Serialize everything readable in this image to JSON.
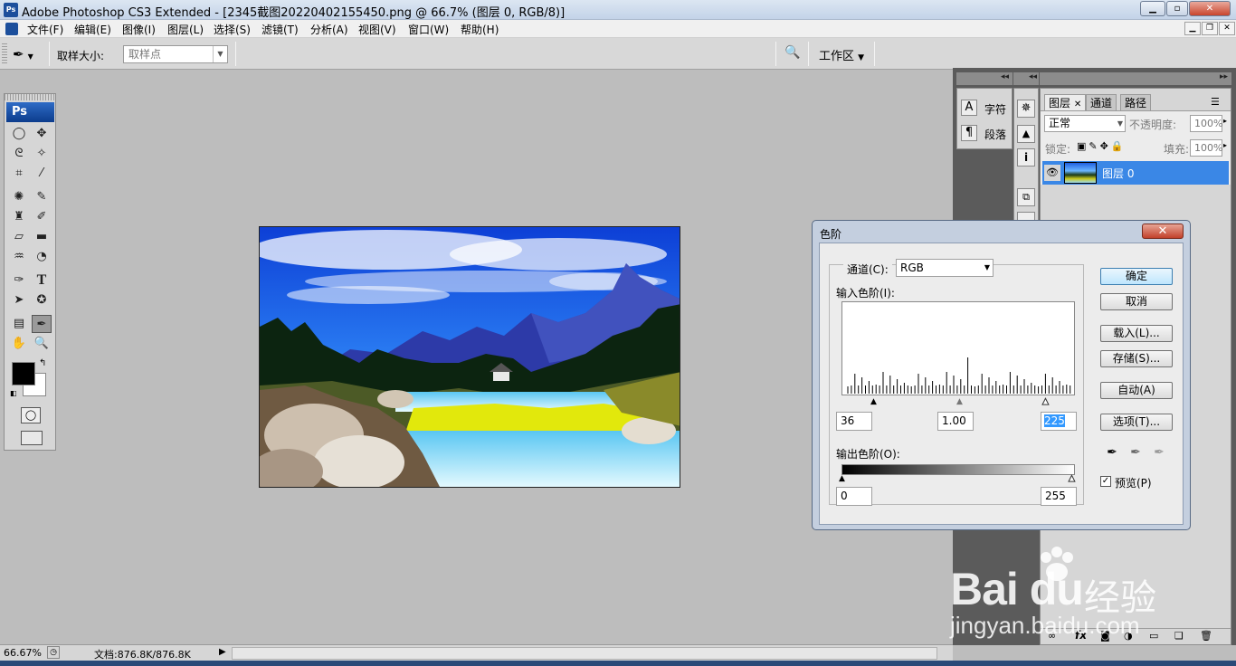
{
  "window": {
    "app_icon": "Ps",
    "title": "Adobe Photoshop CS3 Extended - [2345截图20220402155450.png @ 66.7% (图层 0, RGB/8)]"
  },
  "menu": [
    "文件(F)",
    "编辑(E)",
    "图像(I)",
    "图层(L)",
    "选择(S)",
    "滤镜(T)",
    "分析(A)",
    "视图(V)",
    "窗口(W)",
    "帮助(H)"
  ],
  "options": {
    "sample_size_label": "取样大小:",
    "sample_size_value": "取样点",
    "workspace_label": "工作区"
  },
  "toolbox": {
    "logo": "Ps",
    "type_tool": "T"
  },
  "char_panel": {
    "character": "字符",
    "paragraph": "段落"
  },
  "layers": {
    "tabs": [
      "图层",
      "通道",
      "路径"
    ],
    "blend_mode": "正常",
    "opacity_label": "不透明度:",
    "opacity_value": "100%",
    "lock_label": "锁定:",
    "fill_label": "填充:",
    "fill_value": "100%",
    "layer_name": "图层 0"
  },
  "status": {
    "zoom": "66.67%",
    "doc_info": "文档:876.8K/876.8K"
  },
  "levels_dialog": {
    "title": "色阶",
    "channel_label": "通道(C):",
    "channel_value": "RGB",
    "input_label": "输入色阶(I):",
    "input_black": "36",
    "input_gamma": "1.00",
    "input_white": "225",
    "output_label": "输出色阶(O):",
    "output_black": "0",
    "output_white": "255",
    "ok": "确定",
    "cancel": "取消",
    "load": "载入(L)...",
    "save": "存储(S)...",
    "auto": "自动(A)",
    "options": "选项(T)...",
    "preview": "预览(P)",
    "preview_checked": true
  },
  "watermark": {
    "brand": "Bai  du",
    "brand_cn": "经验",
    "url": "jingyan.baidu.com"
  },
  "colors": {
    "accent": "#3a87e6",
    "dialog_frame": "#c4cfdf",
    "workspace": "#bdbdbd"
  }
}
